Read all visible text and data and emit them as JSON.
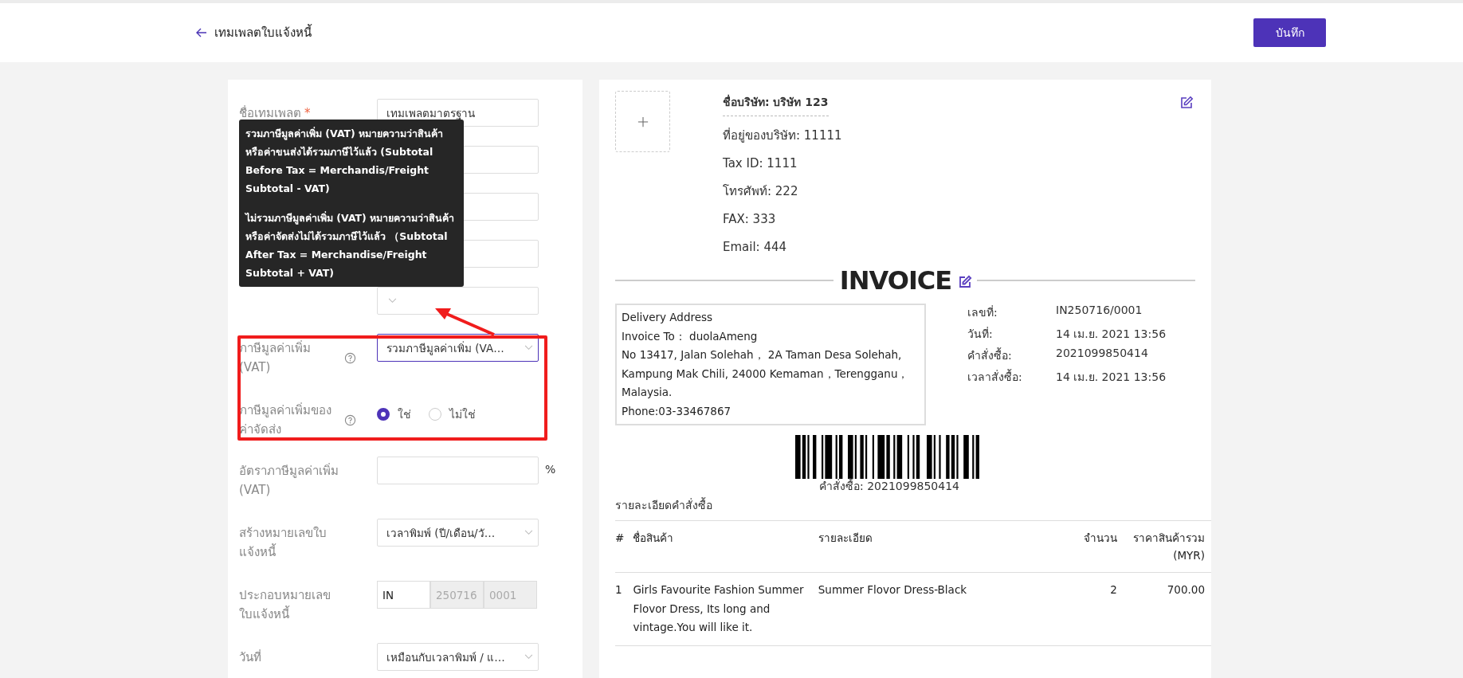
{
  "header": {
    "back_label": "เทมเพลตใบแจ้งหนี้",
    "save_button": "บันทึก"
  },
  "form": {
    "fields": [
      {
        "kind": "text",
        "label": "ชื่อเทมเพลต",
        "required_mark": "*",
        "help": false,
        "value": "เทมเพลตมาตรฐาน",
        "focused": false
      },
      {
        "kind": "select",
        "help": false,
        "focused": false
      },
      {
        "kind": "select",
        "help": false,
        "focused": false
      },
      {
        "kind": "select",
        "help": false,
        "focused": false
      },
      {
        "kind": "select",
        "help": false,
        "focused": false
      },
      {
        "kind": "select",
        "label": "ภาษีมูลค่าเพิ่ม (VAT)",
        "help": true,
        "value": "รวมภาษีมูลค่าเพิ่ม (VA…",
        "focused": true
      },
      {
        "kind": "radio",
        "label": "ภาษีมูลค่าเพิ่มของค่าจัดส่ง",
        "help": true,
        "options": [
          {
            "label": "ใช่",
            "selected": true
          },
          {
            "label": "ไม่ใช่",
            "selected": false
          }
        ]
      },
      {
        "kind": "text",
        "label": "อัตราภาษีมูลค่าเพิ่ม (VAT)",
        "help": false,
        "suffix": "%",
        "focused": false
      },
      {
        "kind": "select",
        "label": "สร้างหมายเลขใบแจ้งหนี้",
        "help": false,
        "value": "เวลาพิมพ์ (ปี/เดือน/วั…",
        "focused": false
      },
      {
        "kind": "parts",
        "label": "ประกอบหมายเลขใบแจ้งหนี้",
        "help": false,
        "parts": [
          {
            "value": "IN",
            "disabled": false
          },
          {
            "value": "250716",
            "disabled": true
          },
          {
            "value": "0001",
            "disabled": true
          }
        ]
      },
      {
        "kind": "select",
        "label": "วันที่",
        "help": false,
        "value": "เหมือนกับเวลาพิมพ์ / แ…",
        "focused": false
      }
    ],
    "tooltip": {
      "paragraphs": [
        "รวมภาษีมูลค่าเพิ่ม (VAT) หมายความว่าสินค้าหรือค่าขนส่งได้รวมภาษีไว้แล้ว (Subtotal Before Tax = Merchandis/Freight Subtotal - VAT)",
        "ไม่รวมภาษีมูลค่าเพิ่ม (VAT) หมายความว่าสินค้าหรือค่าจัดส่งไม่ได้รวมภาษีไว้แล้ว （Subtotal After Tax = Merchandise/Freight Subtotal + VAT)"
      ]
    }
  },
  "invoice": {
    "company_name": "ชื่อบริษัท: บริษัท 123",
    "company_lines": [
      "ที่อยู่ของบริษัท: 11111",
      "Tax ID: 1111",
      "โทรศัพท์: 222",
      "FAX: 333",
      "Email:  444"
    ],
    "title": "INVOICE",
    "address_lines": [
      "Delivery Address",
      "Invoice To：  duolaAmeng",
      "No 13417, Jalan Solehah， 2A Taman Desa Solehah, Kampung Mak Chili, 24000 Kemaman，Terengganu， Malaysia.",
      "Phone:03-33467867"
    ],
    "meta": [
      {
        "label": "เลขที่:",
        "value": "IN250716/0001"
      },
      {
        "label": "วันที่:",
        "value": "14 เม.ย. 2021 13:56"
      },
      {
        "label": "คำสั่งซื้อ:",
        "value": "2021099850414"
      },
      {
        "label": "เวลาสั่งซื้อ:",
        "value": "14 เม.ย. 2021 13:56"
      }
    ],
    "barcode_caption": "คำสั่งซื้อ: 2021099850414",
    "details_title": "รายละเอียดคำสั่งซื้อ",
    "table": {
      "columns": [
        "#",
        "ชื่อสินค้า",
        "รายละเอียด",
        "จำนวน",
        "ราคาสินค้ารวม (MYR)"
      ],
      "rows": [
        [
          "1",
          "Girls Favourite Fashion Summer Flovor Dress, Its long and vintage.You will like it.",
          "Summer Flovor Dress-Black",
          "2",
          "700.00"
        ]
      ]
    }
  }
}
